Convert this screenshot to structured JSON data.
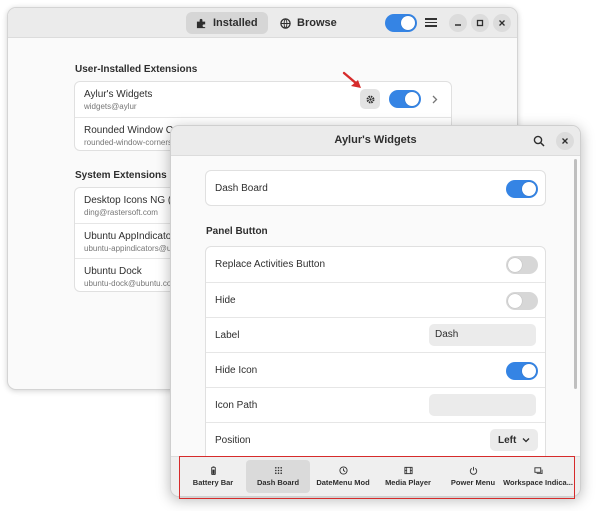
{
  "main_window": {
    "tabs": [
      {
        "label": "Installed",
        "icon": "puzzle-icon",
        "active": true
      },
      {
        "label": "Browse",
        "icon": "globe-icon",
        "active": false
      }
    ],
    "extensions_enabled": true,
    "user_section": {
      "title": "User-Installed Extensions",
      "items": [
        {
          "name": "Aylur's Widgets",
          "id": "widgets@aylur",
          "enabled": true
        },
        {
          "name": "Rounded Window Corners",
          "id": "rounded-window-corners"
        }
      ]
    },
    "system_section": {
      "title": "System Extensions",
      "items": [
        {
          "name": "Desktop Icons NG (DING)",
          "id": "ding@rastersoft.com"
        },
        {
          "name": "Ubuntu AppIndicators",
          "id": "ubuntu-appindicators@ubuntu.com"
        },
        {
          "name": "Ubuntu Dock",
          "id": "ubuntu-dock@ubuntu.com"
        }
      ]
    }
  },
  "pref_window": {
    "title": "Aylur's Widgets",
    "dash_board": {
      "label": "Dash Board",
      "enabled": true
    },
    "panel_button": {
      "title": "Panel Button",
      "replace_activities": {
        "label": "Replace Activities Button",
        "enabled": false
      },
      "hide": {
        "label": "Hide",
        "enabled": false
      },
      "label": {
        "label": "Label",
        "value": "Dash"
      },
      "hide_icon": {
        "label": "Hide Icon",
        "enabled": true
      },
      "icon_path": {
        "label": "Icon Path",
        "value": ""
      },
      "position": {
        "label": "Position",
        "value": "Left"
      }
    },
    "bottom_tabs": [
      {
        "label": "Battery Bar",
        "icon": "battery-icon",
        "active": false
      },
      {
        "label": "Dash Board",
        "icon": "grid-icon",
        "active": true
      },
      {
        "label": "DateMenu Mod",
        "icon": "clock-icon",
        "active": false
      },
      {
        "label": "Media Player",
        "icon": "film-icon",
        "active": false
      },
      {
        "label": "Power Menu",
        "icon": "power-icon",
        "active": false
      },
      {
        "label": "Workspace Indica...",
        "icon": "window-icon",
        "active": false
      }
    ]
  },
  "colors": {
    "accent": "#3584e4",
    "annotation": "#d62b2b"
  }
}
